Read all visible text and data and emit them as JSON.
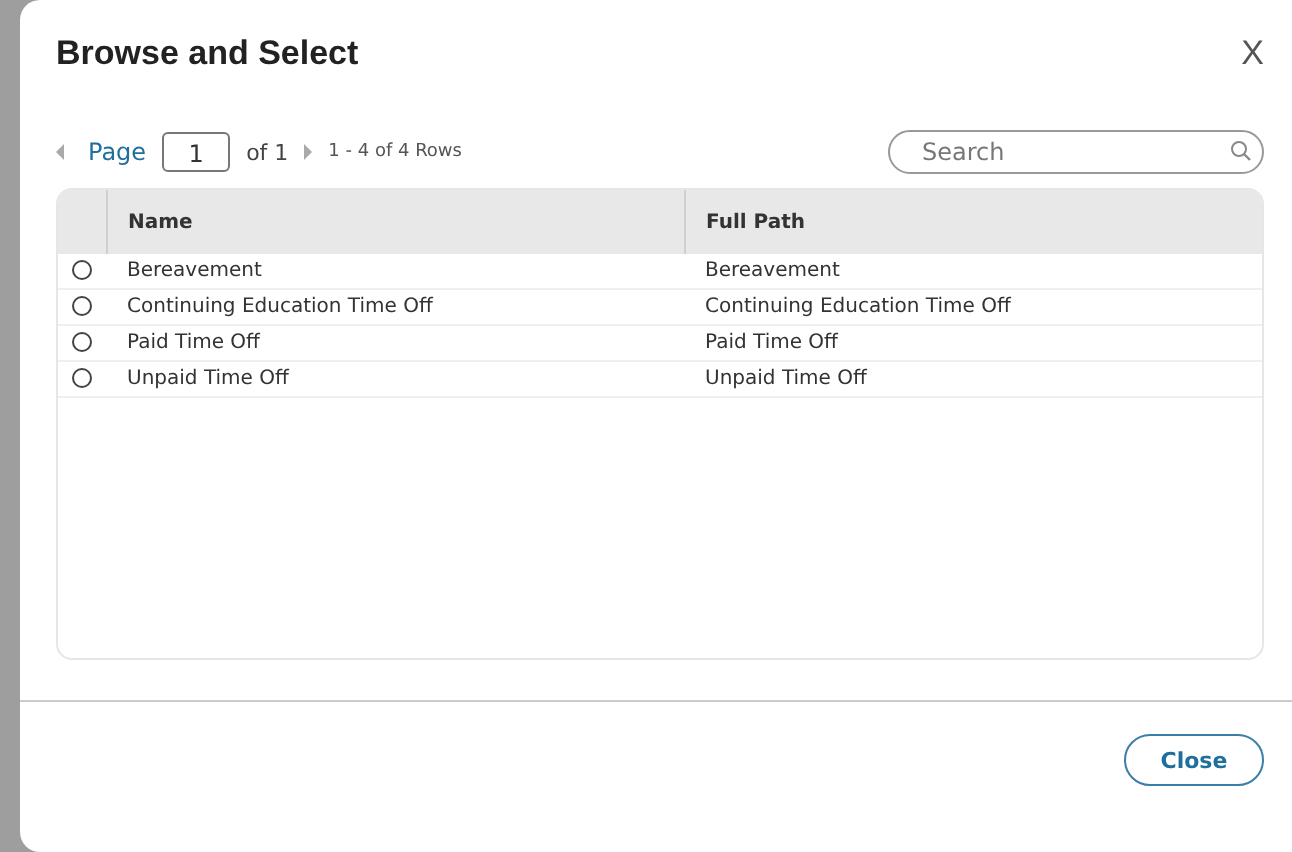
{
  "dialog": {
    "title": "Browse and Select",
    "close_icon": "X"
  },
  "pager": {
    "page_label": "Page",
    "page_value": "1",
    "of_label": "of 1",
    "rows_label": "1 - 4 of 4 Rows"
  },
  "search": {
    "placeholder": "Search"
  },
  "table": {
    "columns": [
      "Name",
      "Full Path"
    ],
    "rows": [
      {
        "selected": false,
        "name": "Bereavement",
        "full_path": "Bereavement"
      },
      {
        "selected": false,
        "name": "Continuing Education Time Off",
        "full_path": "Continuing Education Time Off"
      },
      {
        "selected": false,
        "name": "Paid Time Off",
        "full_path": "Paid Time Off"
      },
      {
        "selected": false,
        "name": "Unpaid Time Off",
        "full_path": "Unpaid Time Off"
      }
    ]
  },
  "buttons": [
    "Close"
  ]
}
